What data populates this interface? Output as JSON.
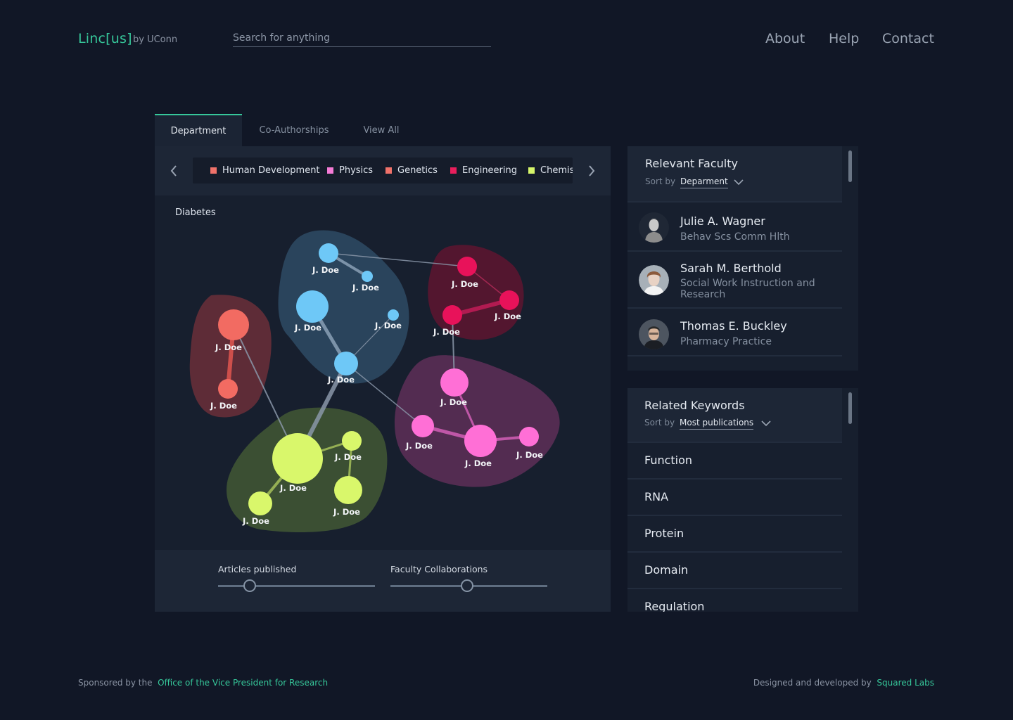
{
  "header": {
    "logo": "Linc[us]",
    "logo_sub": "by UConn",
    "search_placeholder": "Search for anything",
    "nav": [
      "About",
      "Help",
      "Contact"
    ]
  },
  "tabs": [
    {
      "label": "Department",
      "active": true
    },
    {
      "label": "Co-Authorships",
      "active": false
    },
    {
      "label": "View All",
      "active": false
    }
  ],
  "legend": [
    {
      "label": "Human Development",
      "color": "#f0726a"
    },
    {
      "label": "Physics",
      "color": "#f57bd6"
    },
    {
      "label": "Genetics",
      "color": "#f0726a"
    },
    {
      "label": "Engineering",
      "color": "#e81e5c"
    },
    {
      "label": "Chemis",
      "color": "#d6f56a"
    }
  ],
  "graph": {
    "topic": "Diabetes",
    "node_label": "J. Doe",
    "colors": {
      "blue": "#6ec8f7",
      "red": "#e8125a",
      "salmon": "#f26b62",
      "lime": "#d9f76b",
      "pink": "#ff6fd6"
    }
  },
  "sliders": [
    {
      "label": "Articles published",
      "value": 0.2
    },
    {
      "label": "Faculty Collaborations",
      "value": 0.49
    }
  ],
  "faculty": {
    "title": "Relevant Faculty",
    "sort_label": "Sort by",
    "sort_value": "Deparment",
    "items": [
      {
        "name": "Julie A. Wagner",
        "dept": "Behav Scs Comm Hlth"
      },
      {
        "name": "Sarah M. Berthold",
        "dept": "Social Work Instruction and Research"
      },
      {
        "name": "Thomas E. Buckley",
        "dept": "Pharmacy Practice"
      }
    ]
  },
  "keywords": {
    "title": "Related Keywords",
    "sort_label": "Sort by",
    "sort_value": "Most publications",
    "items": [
      "Function",
      "RNA",
      "Protein",
      "Domain",
      "Regulation"
    ]
  },
  "footer": {
    "left_prefix": "Sponsored by the",
    "left_link": "Office of the Vice President for Research",
    "right_prefix": "Designed and developed by",
    "right_link": "Squared Labs"
  }
}
